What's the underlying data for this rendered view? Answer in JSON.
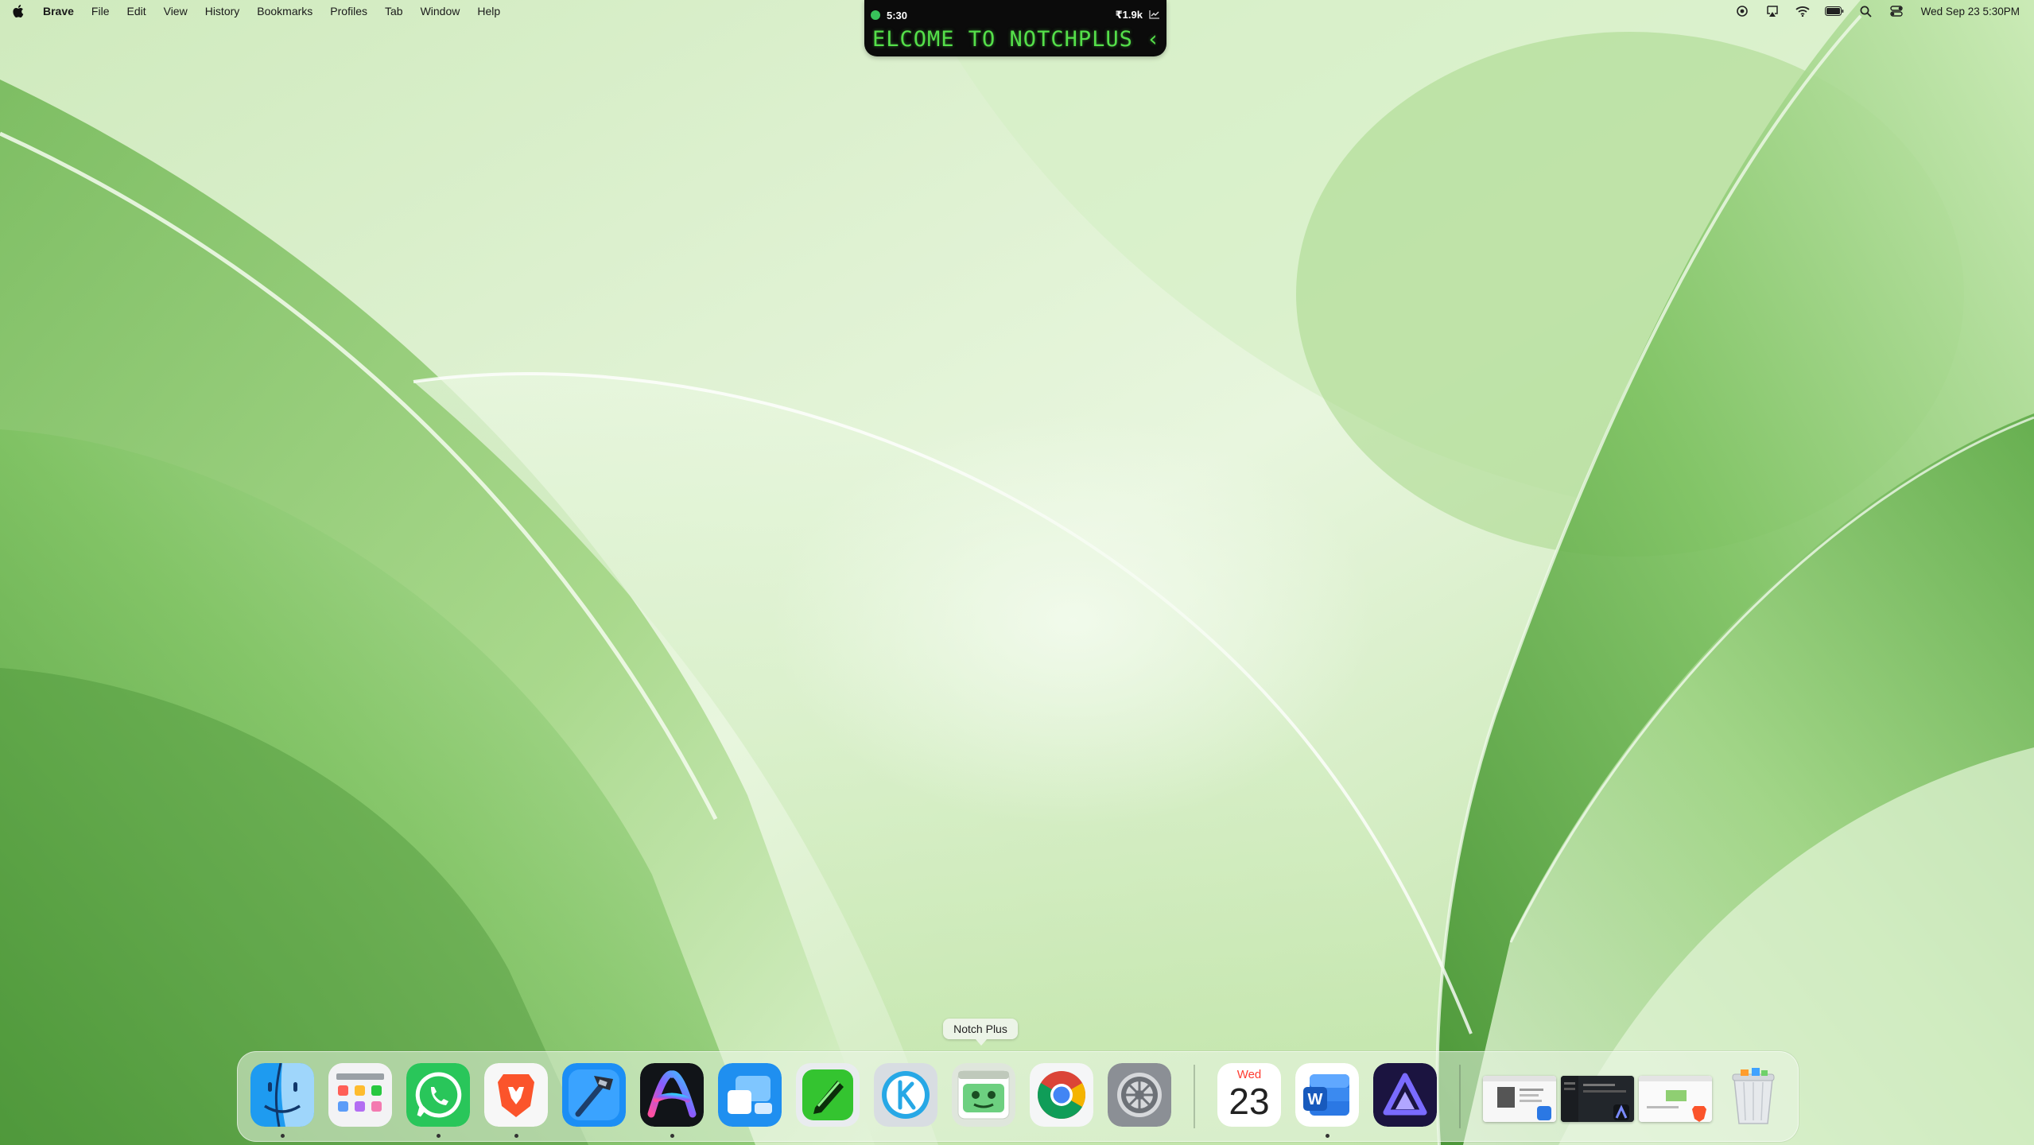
{
  "menubar": {
    "app_name": "Brave",
    "items": [
      {
        "label": "File"
      },
      {
        "label": "Edit"
      },
      {
        "label": "View"
      },
      {
        "label": "History"
      },
      {
        "label": "Bookmarks"
      },
      {
        "label": "Profiles"
      },
      {
        "label": "Tab"
      },
      {
        "label": "Window"
      },
      {
        "label": "Help"
      }
    ],
    "status_icons": [
      "focus-icon",
      "airplay-icon",
      "wifi-icon",
      "battery-icon",
      "spotlight-search-icon",
      "control-center-icon"
    ],
    "clock": "Wed Sep 23  5:30PM"
  },
  "notch": {
    "time": "5:30",
    "status_color": "#38c15a",
    "stock_value": "₹1.9k",
    "trend_icon": "chart-trend-icon",
    "ticker_text": "ELCOME TO NOTCHPLUS ‹"
  },
  "tooltip": {
    "label": "Notch Plus"
  },
  "dock": {
    "apps": [
      {
        "name": "Finder",
        "icon": "finder-icon",
        "running": true
      },
      {
        "name": "Launchpad",
        "icon": "launchpad-icon",
        "running": false
      },
      {
        "name": "WhatsApp",
        "icon": "whatsapp-icon",
        "running": true
      },
      {
        "name": "Brave Browser",
        "icon": "brave-icon",
        "running": true
      },
      {
        "name": "Xcode",
        "icon": "xcode-icon",
        "running": false
      },
      {
        "name": "Arc",
        "icon": "arc-icon",
        "running": true
      },
      {
        "name": "Screens",
        "icon": "screens-icon",
        "running": false
      },
      {
        "name": "Script Editor",
        "icon": "pen-icon",
        "running": false
      },
      {
        "name": "Klack",
        "icon": "klack-icon",
        "running": false
      },
      {
        "name": "Notch Plus",
        "icon": "notch-plus-icon",
        "running": false
      },
      {
        "name": "Google Chrome",
        "icon": "chrome-icon",
        "running": false
      },
      {
        "name": "System Settings",
        "icon": "settings-gear-icon",
        "running": false
      }
    ],
    "recent_apps": [
      {
        "name": "Calendar",
        "icon": "calendar-icon",
        "day_name": "Wed",
        "day_number": "23",
        "running": false
      },
      {
        "name": "Microsoft Word",
        "icon": "word-icon",
        "running": true
      },
      {
        "name": "Affinity",
        "icon": "affinity-icon",
        "running": false
      }
    ],
    "minimized_windows": [
      {
        "name": "Word document window",
        "badge_icon": "word-icon"
      },
      {
        "name": "Arc window",
        "badge_icon": "arc-icon"
      },
      {
        "name": "Brave window",
        "badge_icon": "brave-icon"
      }
    ],
    "trash": {
      "name": "Trash",
      "icon": "trash-icon"
    }
  },
  "colors": {
    "wallpaper_light": "#e6f5dc",
    "wallpaper_mid": "#a9d88f",
    "wallpaper_dark": "#4f9e3b"
  }
}
